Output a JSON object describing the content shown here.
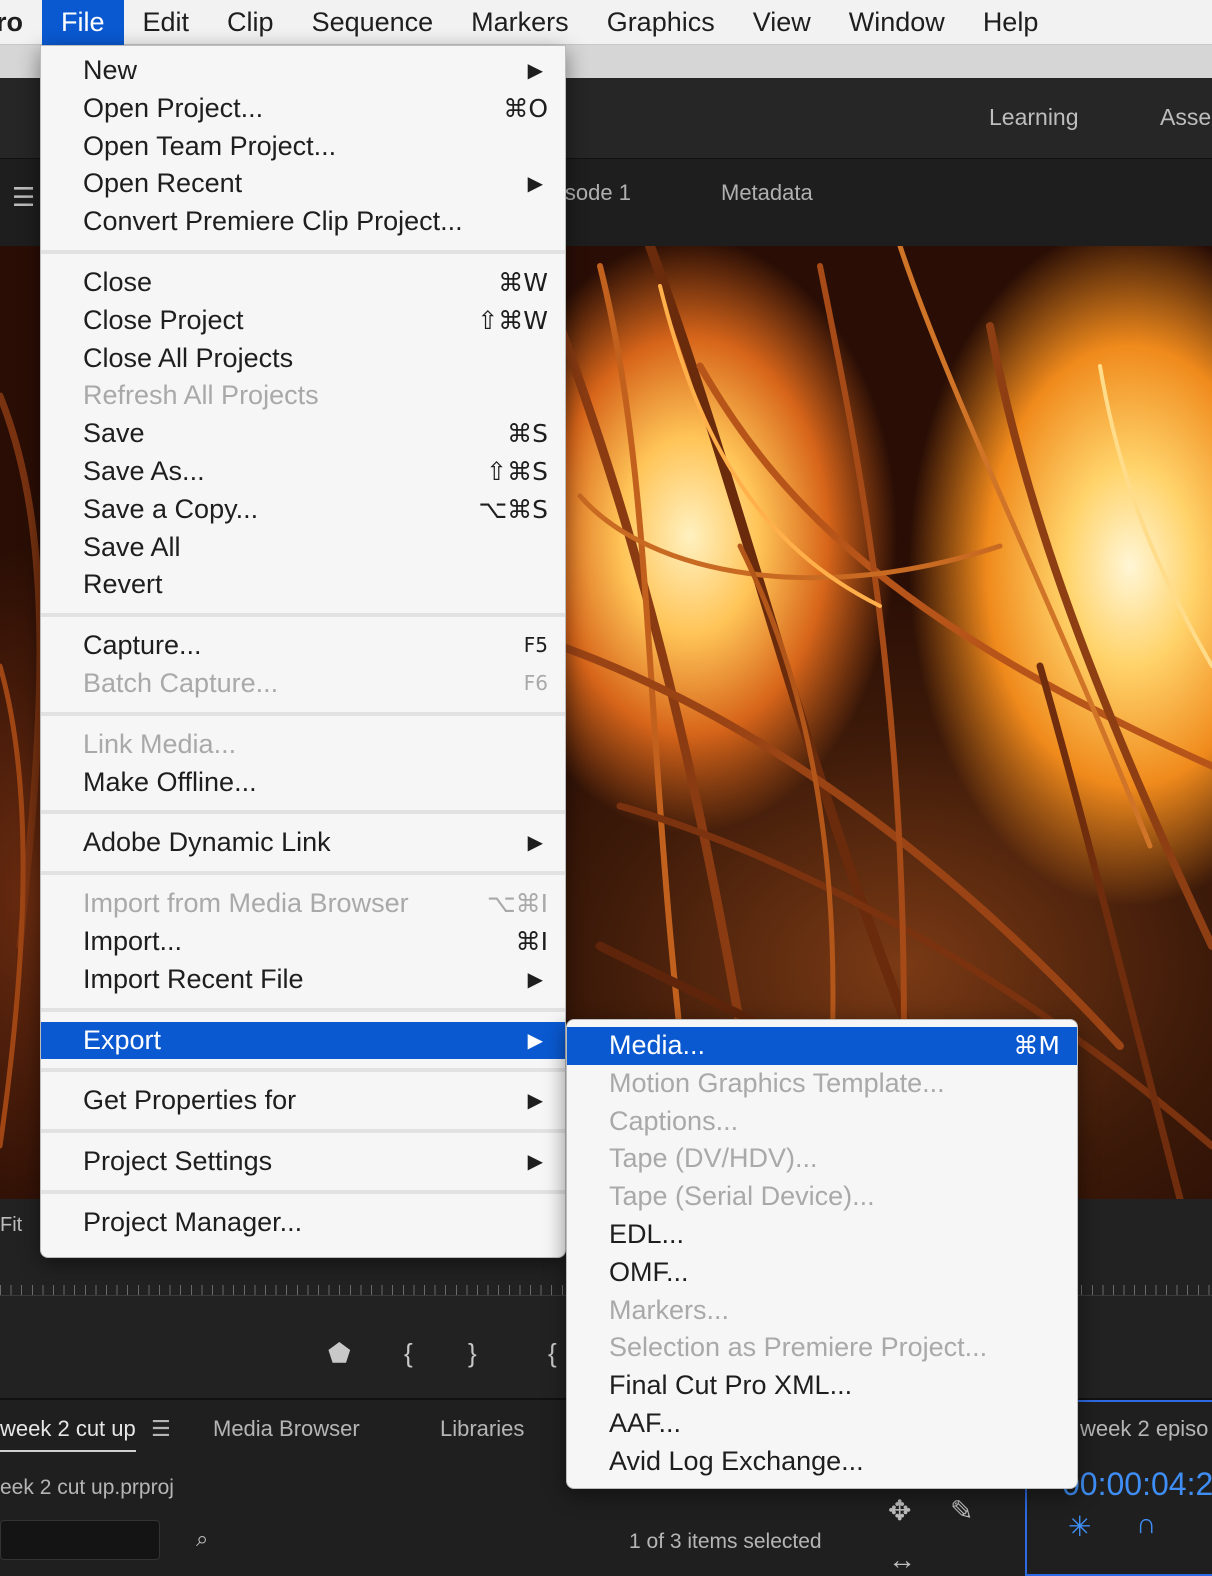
{
  "menubar": {
    "app": "ro",
    "items": [
      "File",
      "Edit",
      "Clip",
      "Sequence",
      "Markers",
      "Graphics",
      "View",
      "Window",
      "Help"
    ],
    "active_index": 0
  },
  "workspace_tabs": [
    "Learning",
    "Asse"
  ],
  "panel_tabs": [
    "isode 1",
    "Metadata"
  ],
  "monitor": {
    "fit_label": "Fit"
  },
  "project_panel": {
    "tabs": [
      "week 2 cut up",
      "Media Browser",
      "Libraries"
    ],
    "file_name": "eek 2 cut up.prproj",
    "selection_status": "1 of 3 items selected"
  },
  "timeline": {
    "tab": "week 2 episo",
    "timecode": "00:00:04:2"
  },
  "file_menu": {
    "groups": [
      [
        {
          "label": "New",
          "submenu": true
        },
        {
          "label": "Open Project...",
          "shortcut": "⌘O"
        },
        {
          "label": "Open Team Project..."
        },
        {
          "label": "Open Recent",
          "submenu": true
        },
        {
          "label": "Convert Premiere Clip Project..."
        }
      ],
      [
        {
          "label": "Close",
          "shortcut": "⌘W"
        },
        {
          "label": "Close Project",
          "shortcut": "⇧⌘W"
        },
        {
          "label": "Close All Projects"
        },
        {
          "label": "Refresh All Projects",
          "disabled": true
        },
        {
          "label": "Save",
          "shortcut": "⌘S"
        },
        {
          "label": "Save As...",
          "shortcut": "⇧⌘S"
        },
        {
          "label": "Save a Copy...",
          "shortcut": "⌥⌘S"
        },
        {
          "label": "Save All"
        },
        {
          "label": "Revert"
        }
      ],
      [
        {
          "label": "Capture...",
          "shortcut": "F5"
        },
        {
          "label": "Batch Capture...",
          "shortcut": "F6",
          "disabled": true
        }
      ],
      [
        {
          "label": "Link Media...",
          "disabled": true
        },
        {
          "label": "Make Offline..."
        }
      ],
      [
        {
          "label": "Adobe Dynamic Link",
          "submenu": true
        }
      ],
      [
        {
          "label": "Import from Media Browser",
          "shortcut": "⌥⌘I",
          "disabled": true
        },
        {
          "label": "Import...",
          "shortcut": "⌘I"
        },
        {
          "label": "Import Recent File",
          "submenu": true
        }
      ],
      [
        {
          "label": "Export",
          "submenu": true,
          "highlighted": true
        }
      ],
      [
        {
          "label": "Get Properties for",
          "submenu": true
        }
      ],
      [
        {
          "label": "Project Settings",
          "submenu": true
        }
      ],
      [
        {
          "label": "Project Manager..."
        }
      ]
    ]
  },
  "export_menu": {
    "items": [
      {
        "label": "Media...",
        "shortcut": "⌘M",
        "highlighted": true
      },
      {
        "label": "Motion Graphics Template...",
        "disabled": true
      },
      {
        "label": "Captions...",
        "disabled": true
      },
      {
        "label": "Tape (DV/HDV)...",
        "disabled": true
      },
      {
        "label": "Tape (Serial Device)...",
        "disabled": true
      },
      {
        "label": "EDL..."
      },
      {
        "label": "OMF..."
      },
      {
        "label": "Markers...",
        "disabled": true
      },
      {
        "label": "Selection as Premiere Project...",
        "disabled": true
      },
      {
        "label": "Final Cut Pro XML..."
      },
      {
        "label": "AAF..."
      },
      {
        "label": "Avid Log Exchange..."
      }
    ]
  },
  "colors": {
    "highlight": "#0a59d1",
    "menu_bg": "#f6f6f6",
    "disabled_text": "#a9a9a9",
    "timecode": "#3f8ef5"
  },
  "icons": {
    "submenu_arrow": "▶",
    "hamburger": "☰"
  }
}
